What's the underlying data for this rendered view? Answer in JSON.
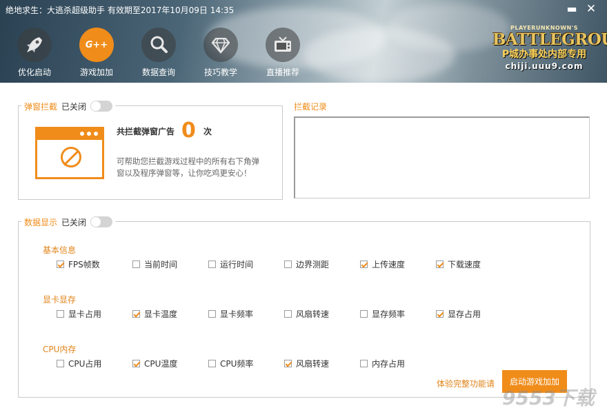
{
  "window": {
    "title": "绝地求生：大逃杀超级助手 有效期至2017年10月09日 14:35",
    "min_glyph": "▬",
    "close_glyph": "✕"
  },
  "nav": [
    {
      "label": "优化启动",
      "icon": "rocket-icon",
      "active": false
    },
    {
      "label": "游戏加加",
      "icon": "g-plus-plus-icon",
      "active": true
    },
    {
      "label": "数据查询",
      "icon": "search-icon",
      "active": false
    },
    {
      "label": "技巧教学",
      "icon": "diamond-icon",
      "active": false
    },
    {
      "label": "直播推荐",
      "icon": "tv-icon",
      "active": false
    }
  ],
  "logo": {
    "small": "PLAYERUNKNOWN'S",
    "big": "BATTLEGROUNDS",
    "sub": "P城办事处内部专用",
    "url": "chiji.uuu9.com",
    "g_text": "G++"
  },
  "popup_block": {
    "title": "弹窗拦截",
    "toggle_label": "已关闭",
    "count_label": "共拦截弹窗广告",
    "count": "0",
    "count_unit": "次",
    "description": "可帮助您拦截游戏过程中的所有右下角弹窗以及程序弹窗等，让你吃鸡更安心！"
  },
  "block_record": {
    "title": "拦截记录"
  },
  "data_display": {
    "title": "数据显示",
    "toggle_label": "已关闭",
    "groups": [
      {
        "title": "基本信息",
        "items": [
          {
            "label": "FPS帧数",
            "checked": true
          },
          {
            "label": "当前时间",
            "checked": false
          },
          {
            "label": "运行时间",
            "checked": false
          },
          {
            "label": "边界测距",
            "checked": false
          },
          {
            "label": "上传速度",
            "checked": true
          },
          {
            "label": "下载速度",
            "checked": true
          }
        ]
      },
      {
        "title": "显卡显存",
        "items": [
          {
            "label": "显卡占用",
            "checked": false
          },
          {
            "label": "显卡温度",
            "checked": true
          },
          {
            "label": "显卡频率",
            "checked": false
          },
          {
            "label": "风扇转速",
            "checked": false
          },
          {
            "label": "显存频率",
            "checked": false
          },
          {
            "label": "显存占用",
            "checked": true
          }
        ]
      },
      {
        "title": "CPU内存",
        "items": [
          {
            "label": "CPU占用",
            "checked": false
          },
          {
            "label": "CPU温度",
            "checked": true
          },
          {
            "label": "CPU频率",
            "checked": false
          },
          {
            "label": "风扇转速",
            "checked": true
          },
          {
            "label": "内存占用",
            "checked": false
          }
        ]
      }
    ],
    "trial_link": "体验完整功能请",
    "start_button": "启动游戏加加"
  },
  "watermark": "9553下载",
  "colors": {
    "accent": "#f08c1a",
    "border": "#c9c9c9"
  }
}
